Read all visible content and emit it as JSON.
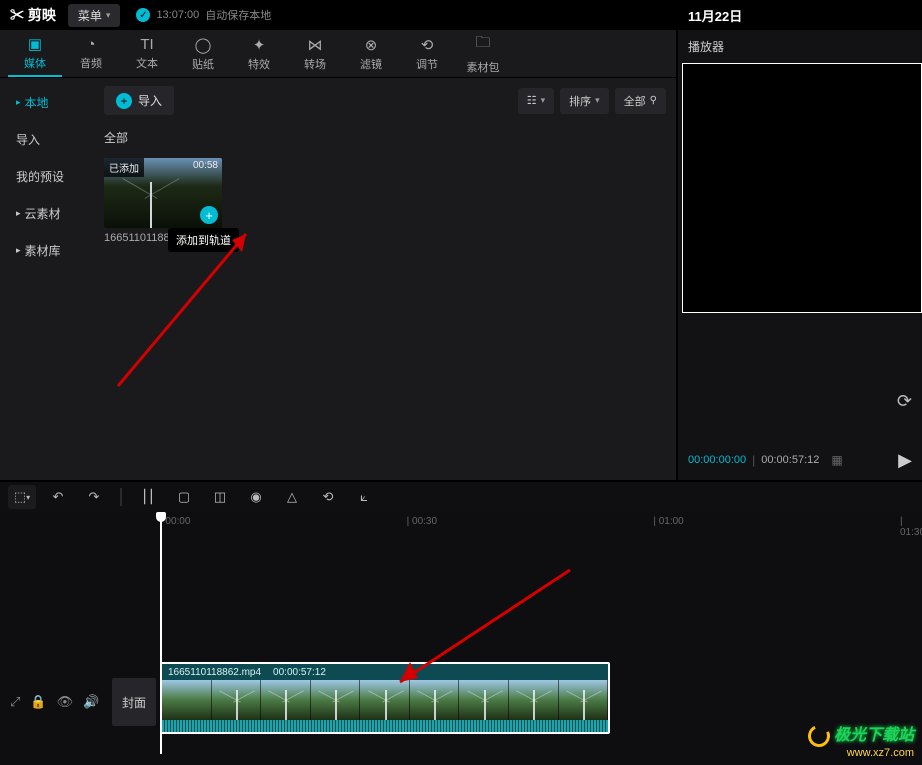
{
  "top": {
    "logo": "✂ 剪映",
    "menu": "菜单",
    "autosave_time": "13:07:00",
    "autosave_text": "自动保存本地",
    "date": "11月22日"
  },
  "tool_tabs": [
    {
      "icon": "▣",
      "label": "媒体"
    },
    {
      "icon": "◔",
      "label": "音频"
    },
    {
      "icon": "TI",
      "label": "文本"
    },
    {
      "icon": "◯",
      "label": "贴纸"
    },
    {
      "icon": "✦",
      "label": "特效"
    },
    {
      "icon": "⋈",
      "label": "转场"
    },
    {
      "icon": "⊗",
      "label": "滤镜"
    },
    {
      "icon": "⟲",
      "label": "调节"
    },
    {
      "icon": "🗀",
      "label": "素材包"
    }
  ],
  "sidebar": [
    {
      "label": "本地",
      "arrow": true,
      "active": true
    },
    {
      "label": "导入",
      "arrow": false
    },
    {
      "label": "我的预设",
      "arrow": false
    },
    {
      "label": "云素材",
      "arrow": true
    },
    {
      "label": "素材库",
      "arrow": true
    }
  ],
  "media": {
    "import_btn": "导入",
    "view_list_icon": "☷",
    "sort_label": "排序",
    "filter_label": "全部",
    "section_label": "全部",
    "clip": {
      "badge": "已添加",
      "duration": "00:58",
      "tooltip": "添加到轨道",
      "filename": "1665110118862.mp4"
    }
  },
  "player": {
    "title": "播放器",
    "current": "00:00:00:00",
    "total": "00:00:57:12"
  },
  "timeline": {
    "marks": [
      "00:00",
      "00:30",
      "01:00",
      "01:30"
    ],
    "cover_btn": "封面",
    "clip_name": "1665110118862.mp4",
    "clip_dur": "00:00:57:12"
  },
  "watermark": {
    "line1": "极光下载站",
    "line2": "www.xz7.com"
  }
}
